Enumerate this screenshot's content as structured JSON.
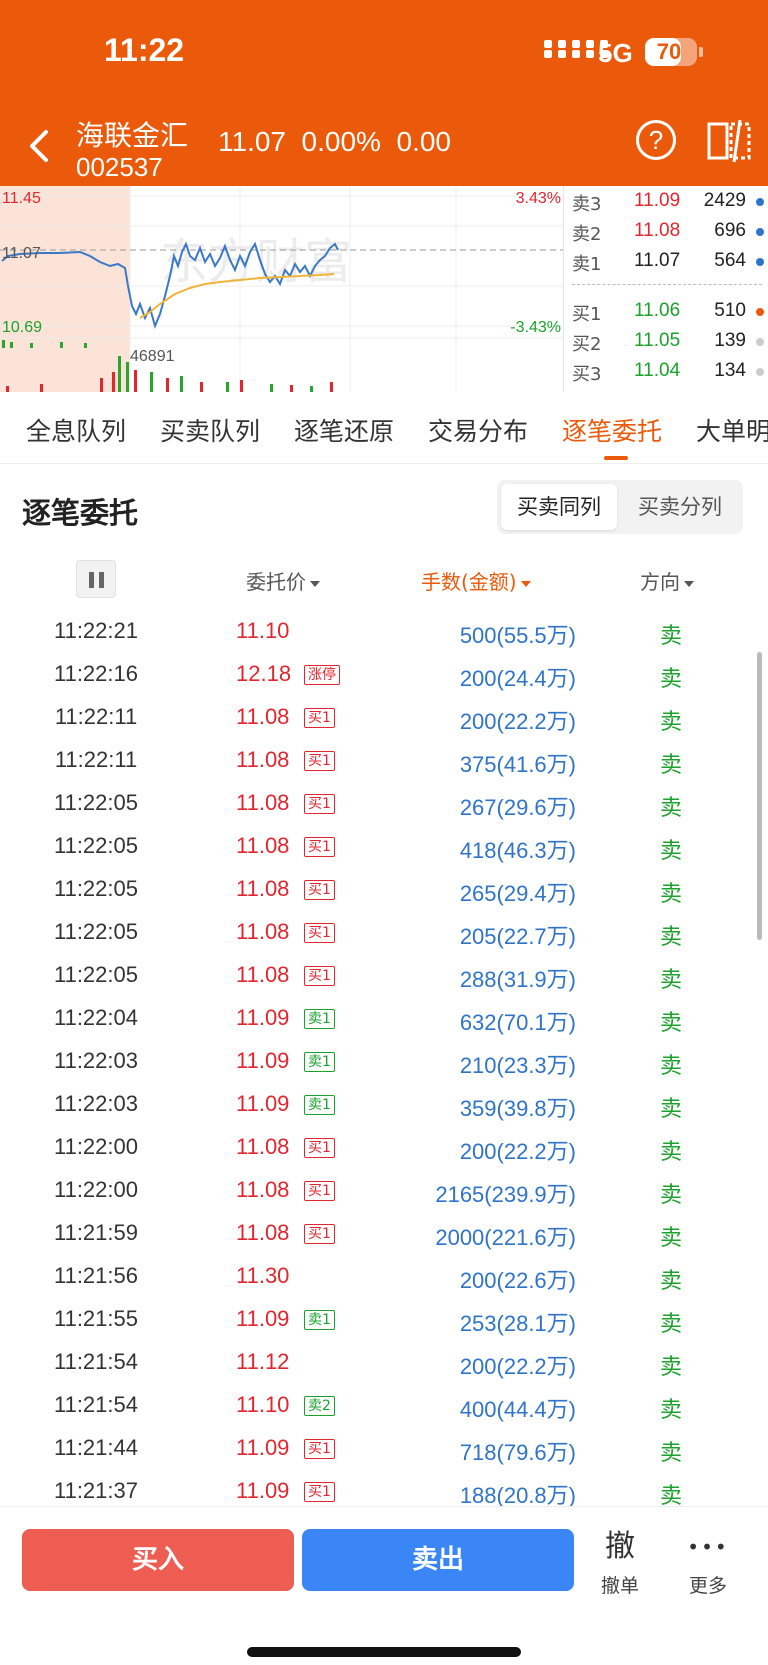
{
  "status": {
    "time": "11:22",
    "network": "5G",
    "battery": "70",
    "battery_level": 0.7
  },
  "header": {
    "name": "海联金汇",
    "code": "002537",
    "quote": "11.07  0.00%  0.00"
  },
  "chart": {
    "high": "11.45",
    "mid": "11.07",
    "low": "10.69",
    "pct_high": "3.43%",
    "pct_low": "-3.43%",
    "volume": "46891",
    "watermark": "东方财富"
  },
  "orderbook": {
    "asks": [
      {
        "label": "卖3",
        "price": "11.09",
        "vol": "2429"
      },
      {
        "label": "卖2",
        "price": "11.08",
        "vol": "696"
      },
      {
        "label": "卖1",
        "price": "11.07",
        "vol": "564"
      }
    ],
    "bids": [
      {
        "label": "买1",
        "price": "11.06",
        "vol": "510"
      },
      {
        "label": "买2",
        "price": "11.05",
        "vol": "139"
      },
      {
        "label": "买3",
        "price": "11.04",
        "vol": "134"
      }
    ],
    "colors": {
      "ask": "#e3262d",
      "bid": "#1aa22b",
      "ask_price_1": "#222",
      "dot_blue": "#2f74c9",
      "dot_red": "#ea5a0a",
      "dot_gray": "#ccc"
    }
  },
  "tabs": [
    "全息队列",
    "买卖队列",
    "逐笔还原",
    "交易分布",
    "逐笔委托",
    "大单明"
  ],
  "active_tab": 4,
  "section": {
    "title": "逐笔委托",
    "seg_same": "买卖同列",
    "seg_split": "买卖分列"
  },
  "columns": {
    "price": "委托价",
    "amount": "手数(金额)",
    "direction": "方向"
  },
  "rows": [
    {
      "time": "11:22:21",
      "price": "11.10",
      "tag": "",
      "tag_type": "",
      "amount": "500(55.5万)",
      "dir": "卖"
    },
    {
      "time": "11:22:16",
      "price": "12.18",
      "tag": "涨停",
      "tag_type": "buy",
      "amount": "200(24.4万)",
      "dir": "卖"
    },
    {
      "time": "11:22:11",
      "price": "11.08",
      "tag": "买1",
      "tag_type": "buy",
      "amount": "200(22.2万)",
      "dir": "卖"
    },
    {
      "time": "11:22:11",
      "price": "11.08",
      "tag": "买1",
      "tag_type": "buy",
      "amount": "375(41.6万)",
      "dir": "卖"
    },
    {
      "time": "11:22:05",
      "price": "11.08",
      "tag": "买1",
      "tag_type": "buy",
      "amount": "267(29.6万)",
      "dir": "卖"
    },
    {
      "time": "11:22:05",
      "price": "11.08",
      "tag": "买1",
      "tag_type": "buy",
      "amount": "418(46.3万)",
      "dir": "卖"
    },
    {
      "time": "11:22:05",
      "price": "11.08",
      "tag": "买1",
      "tag_type": "buy",
      "amount": "265(29.4万)",
      "dir": "卖"
    },
    {
      "time": "11:22:05",
      "price": "11.08",
      "tag": "买1",
      "tag_type": "buy",
      "amount": "205(22.7万)",
      "dir": "卖"
    },
    {
      "time": "11:22:05",
      "price": "11.08",
      "tag": "买1",
      "tag_type": "buy",
      "amount": "288(31.9万)",
      "dir": "卖"
    },
    {
      "time": "11:22:04",
      "price": "11.09",
      "tag": "卖1",
      "tag_type": "sell",
      "amount": "632(70.1万)",
      "dir": "卖"
    },
    {
      "time": "11:22:03",
      "price": "11.09",
      "tag": "卖1",
      "tag_type": "sell",
      "amount": "210(23.3万)",
      "dir": "卖"
    },
    {
      "time": "11:22:03",
      "price": "11.09",
      "tag": "卖1",
      "tag_type": "sell",
      "amount": "359(39.8万)",
      "dir": "卖"
    },
    {
      "time": "11:22:00",
      "price": "11.08",
      "tag": "买1",
      "tag_type": "buy",
      "amount": "200(22.2万)",
      "dir": "卖"
    },
    {
      "time": "11:22:00",
      "price": "11.08",
      "tag": "买1",
      "tag_type": "buy",
      "amount": "2165(239.9万)",
      "dir": "卖"
    },
    {
      "time": "11:21:59",
      "price": "11.08",
      "tag": "买1",
      "tag_type": "buy",
      "amount": "2000(221.6万)",
      "dir": "卖"
    },
    {
      "time": "11:21:56",
      "price": "11.30",
      "tag": "",
      "tag_type": "",
      "amount": "200(22.6万)",
      "dir": "卖"
    },
    {
      "time": "11:21:55",
      "price": "11.09",
      "tag": "卖1",
      "tag_type": "sell",
      "amount": "253(28.1万)",
      "dir": "卖"
    },
    {
      "time": "11:21:54",
      "price": "11.12",
      "tag": "",
      "tag_type": "",
      "amount": "200(22.2万)",
      "dir": "卖"
    },
    {
      "time": "11:21:54",
      "price": "11.10",
      "tag": "卖2",
      "tag_type": "sell",
      "amount": "400(44.4万)",
      "dir": "卖"
    },
    {
      "time": "11:21:44",
      "price": "11.09",
      "tag": "买1",
      "tag_type": "buy",
      "amount": "718(79.6万)",
      "dir": "卖"
    },
    {
      "time": "11:21:37",
      "price": "11.09",
      "tag": "买1",
      "tag_type": "buy",
      "amount": "188(20.8万)",
      "dir": "卖"
    }
  ],
  "bottom": {
    "buy": "买入",
    "sell": "卖出",
    "cancel_icon": "撤",
    "cancel": "撤单",
    "more_icon": "•••",
    "more": "更多"
  }
}
